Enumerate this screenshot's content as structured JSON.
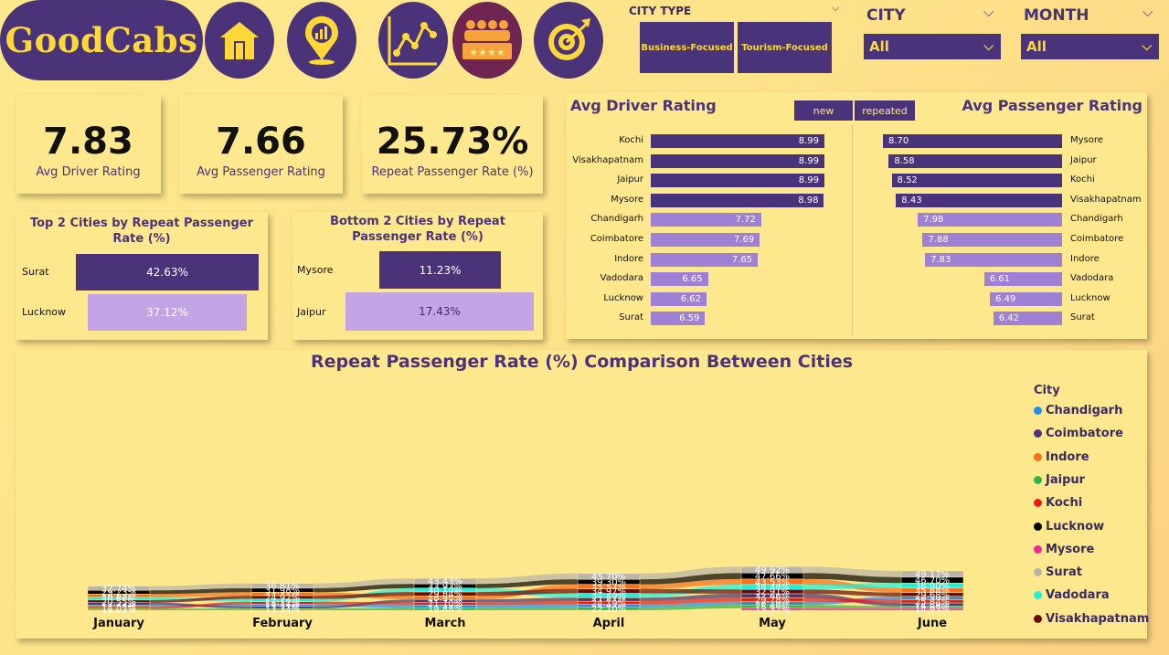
{
  "logo": {
    "text": "GoodCabs"
  },
  "nav": [
    {
      "name": "home-icon",
      "bg": "#4a3379"
    },
    {
      "name": "map-chart-icon",
      "bg": "#4a3379"
    },
    {
      "name": "trend-icon",
      "bg": "#4a3379"
    },
    {
      "name": "rating-icon",
      "bg": "#6e2552"
    },
    {
      "name": "target-icon",
      "bg": "#4a3379"
    }
  ],
  "slicers": {
    "city_type": {
      "label": "CITY TYPE",
      "options": [
        "Business-Focused",
        "Tourism-Focused"
      ]
    },
    "city": {
      "label": "CITY",
      "value": "All"
    },
    "month": {
      "label": "MONTH",
      "value": "All"
    }
  },
  "kpis": [
    {
      "value": "7.83",
      "label": "Avg Driver Rating"
    },
    {
      "value": "7.66",
      "label": "Avg Passenger Rating"
    },
    {
      "value": "25.73%",
      "label": "Repeat Passenger Rate (%)"
    }
  ],
  "top2": {
    "title": "Top 2 Cities by Repeat Passenger Rate (%)",
    "rows": [
      {
        "city": "Surat",
        "value": 42.63,
        "label": "42.63%"
      },
      {
        "city": "Lucknow",
        "value": 37.12,
        "label": "37.12%"
      }
    ]
  },
  "bottom2": {
    "title": "Bottom 2 Cities by Repeat Passenger Rate (%)",
    "rows": [
      {
        "city": "Mysore",
        "value": 11.23,
        "label": "11.23%"
      },
      {
        "city": "Jaipur",
        "value": 17.43,
        "label": "17.43%"
      }
    ]
  },
  "ratings": {
    "driver_title": "Avg Driver Rating",
    "passenger_title": "Avg Passenger Rating",
    "tab_new": "new",
    "tab_repeated": "repeated",
    "driver": [
      {
        "city": "Kochi",
        "value": 8.99,
        "label": "8.99"
      },
      {
        "city": "Visakhapatnam",
        "value": 8.99,
        "label": "8.99"
      },
      {
        "city": "Jaipur",
        "value": 8.99,
        "label": "8.99"
      },
      {
        "city": "Mysore",
        "value": 8.98,
        "label": "8.98"
      },
      {
        "city": "Chandigarh",
        "value": 7.72,
        "label": "7.72"
      },
      {
        "city": "Coimbatore",
        "value": 7.69,
        "label": "7.69"
      },
      {
        "city": "Indore",
        "value": 7.65,
        "label": "7.65"
      },
      {
        "city": "Vadodara",
        "value": 6.65,
        "label": "6.65"
      },
      {
        "city": "Lucknow",
        "value": 6.62,
        "label": "6.62"
      },
      {
        "city": "Surat",
        "value": 6.59,
        "label": "6.59"
      }
    ],
    "passenger": [
      {
        "city": "Mysore",
        "value": 8.7,
        "label": "8.70"
      },
      {
        "city": "Jaipur",
        "value": 8.58,
        "label": "8.58"
      },
      {
        "city": "Kochi",
        "value": 8.52,
        "label": "8.52"
      },
      {
        "city": "Visakhapatnam",
        "value": 8.43,
        "label": "8.43"
      },
      {
        "city": "Chandigarh",
        "value": 7.98,
        "label": "7.98"
      },
      {
        "city": "Coimbatore",
        "value": 7.88,
        "label": "7.88"
      },
      {
        "city": "Indore",
        "value": 7.83,
        "label": "7.83"
      },
      {
        "city": "Vadodara",
        "value": 6.61,
        "label": "6.61"
      },
      {
        "city": "Lucknow",
        "value": 6.49,
        "label": "6.49"
      },
      {
        "city": "Surat",
        "value": 6.42,
        "label": "6.42"
      }
    ]
  },
  "chart_data": {
    "type": "area",
    "subtype": "ribbon",
    "title": "Repeat Passenger Rate (%) Comparison Between Cities",
    "legend_title": "City",
    "legend_position": "right",
    "categories": [
      "January",
      "February",
      "March",
      "April",
      "May",
      "June"
    ],
    "series": [
      {
        "name": "Chandigarh",
        "color": "#1f8ff0",
        "values": [
          15.52,
          17.36,
          21.27,
          24.02,
          26.2,
          26.3
        ]
      },
      {
        "name": "Coimbatore",
        "color": "#4a3379",
        "values": [
          17.71,
          17.21,
          21.73,
          27.87,
          32.66,
          24.69
        ]
      },
      {
        "name": "Indore",
        "color": "#f7701c",
        "values": [
          26.65,
          27.71,
          28.46,
          35.52,
          43.53,
          35.88
        ]
      },
      {
        "name": "Jaipur",
        "color": "#2db54a",
        "values": [
          12.01,
          13.34,
          19.88,
          22.1,
          25.68,
          16.98
        ]
      },
      {
        "name": "Kochi",
        "color": "#f01a1a",
        "values": [
          14.05,
          18.71,
          21.7,
          24.19,
          29.78,
          25.84
        ]
      },
      {
        "name": "Lucknow",
        "color": "#050505",
        "values": [
          29.23,
          31.98,
          33.93,
          39.3,
          47.66,
          46.7
        ]
      },
      {
        "name": "Mysore",
        "color": "#f0259c",
        "values": [
          null,
          null,
          null,
          null,
          15.37,
          14.93
        ]
      },
      {
        "name": "Surat",
        "color": "#b9b4aa",
        "values": [
          32.74,
          36.81,
          43.43,
          45.7,
          49.92,
          49.17
        ]
      },
      {
        "name": "Vadodara",
        "color": "#1ef0dc",
        "values": [
          20.66,
          22.13,
          30.1,
          34.49,
          38.48,
          38.9
        ]
      },
      {
        "name": "Visakhapatnam",
        "color": "#6b0a0a",
        "values": [
          20.55,
          24.92,
          29.84,
          34.97,
          32.91,
          29.68
        ]
      }
    ]
  }
}
